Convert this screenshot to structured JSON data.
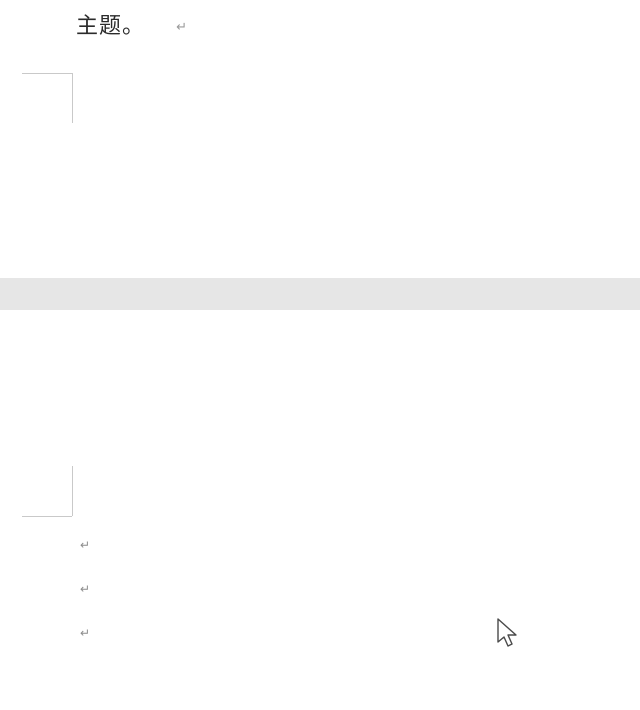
{
  "page1": {
    "text": "主题。",
    "para_mark": "↵"
  },
  "page2": {
    "para_marks": [
      "↵",
      "↵",
      "↵"
    ]
  },
  "glyphs": {
    "para": "↵"
  }
}
